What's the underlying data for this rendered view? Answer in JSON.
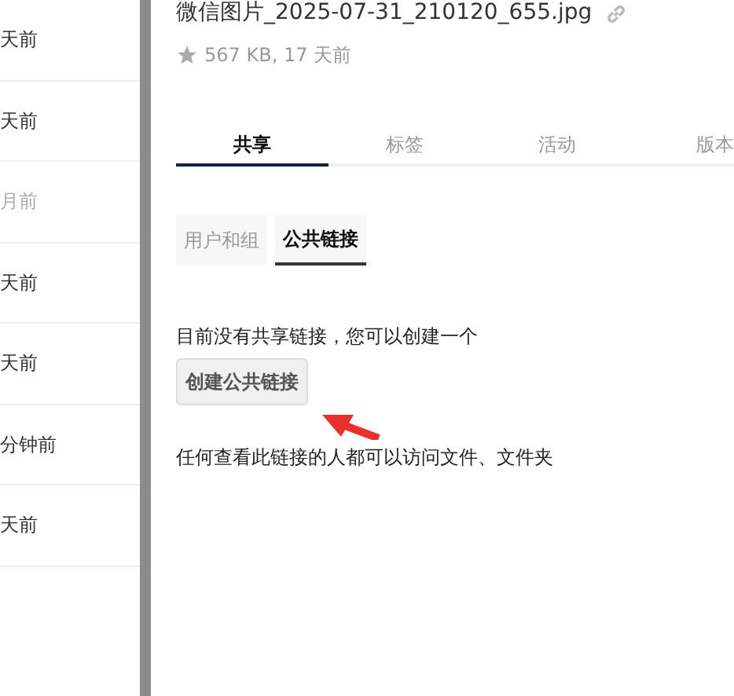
{
  "file_list": [
    {
      "time": "天前",
      "muted": false
    },
    {
      "time": "天前",
      "muted": false
    },
    {
      "time": "月前",
      "muted": true
    },
    {
      "time": "天前",
      "muted": false
    },
    {
      "time": "天前",
      "muted": false
    },
    {
      "time": "分钟前",
      "muted": false
    },
    {
      "time": "天前",
      "muted": false
    }
  ],
  "details": {
    "file_name": "微信图片_2025-07-31_210120_655.jpg",
    "meta": "567 KB, 17 天前",
    "favorite": false,
    "tabs": [
      {
        "label": "共享",
        "selected": true
      },
      {
        "label": "标签",
        "selected": false
      },
      {
        "label": "活动",
        "selected": false
      },
      {
        "label": "版本",
        "selected": false
      }
    ],
    "subtabs": [
      {
        "label": "用户和组",
        "selected": false
      },
      {
        "label": "公共链接",
        "selected": true
      }
    ],
    "empty_message": "目前没有共享链接，您可以创建一个",
    "create_button": "创建公共链接",
    "hint": "任何查看此链接的人都可以访问文件、文件夹"
  }
}
